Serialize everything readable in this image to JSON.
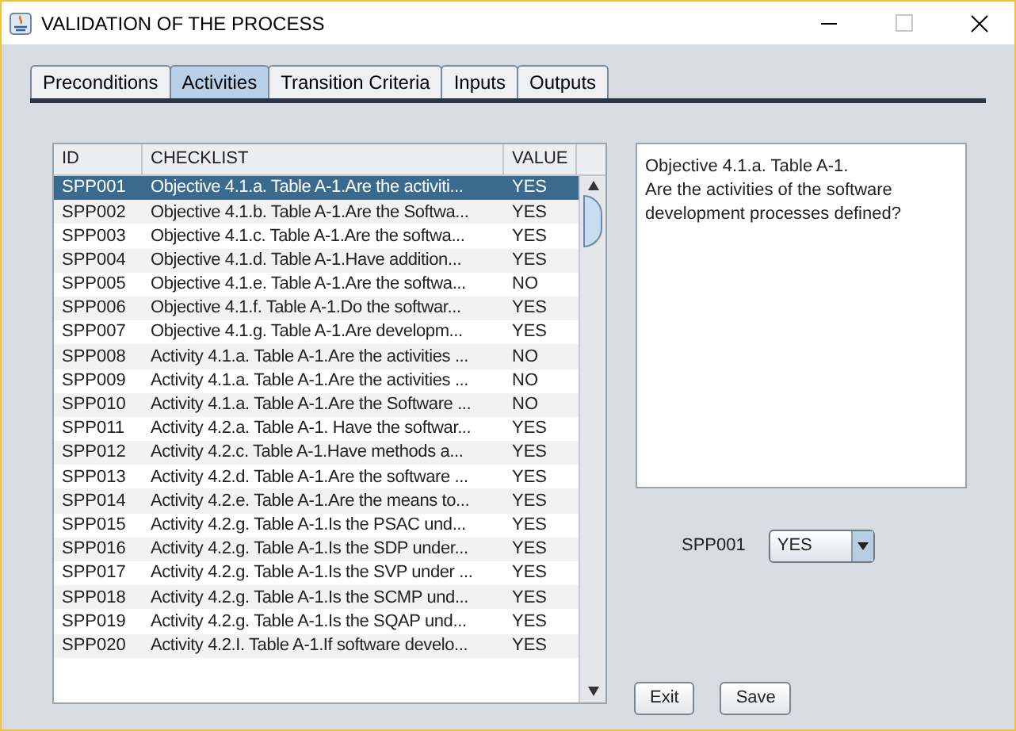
{
  "window": {
    "title": "VALIDATION OF THE PROCESS"
  },
  "tabs": [
    {
      "label": "Preconditions",
      "selected": false
    },
    {
      "label": "Activities",
      "selected": true
    },
    {
      "label": "Transition Criteria",
      "selected": false
    },
    {
      "label": "Inputs",
      "selected": false
    },
    {
      "label": "Outputs",
      "selected": false
    }
  ],
  "table": {
    "columns": [
      "ID",
      "CHECKLIST",
      "VALUE"
    ],
    "rows": [
      {
        "id": "SPP001",
        "checklist": "Objective 4.1.a. Table A-1.Are the activiti...",
        "value": "YES",
        "selected": true
      },
      {
        "id": "SPP002",
        "checklist": "Objective 4.1.b. Table A-1.Are the Softwa...",
        "value": "YES",
        "selected": false
      },
      {
        "id": "SPP003",
        "checklist": "Objective 4.1.c. Table A-1.Are the softwa...",
        "value": "YES",
        "selected": false
      },
      {
        "id": "SPP004",
        "checklist": "Objective 4.1.d. Table A-1.Have addition...",
        "value": "YES",
        "selected": false
      },
      {
        "id": "SPP005",
        "checklist": "Objective 4.1.e. Table A-1.Are the softwa...",
        "value": "NO",
        "selected": false
      },
      {
        "id": "SPP006",
        "checklist": "Objective 4.1.f. Table A-1.Do the softwar...",
        "value": "YES",
        "selected": false
      },
      {
        "id": "SPP007",
        "checklist": "Objective 4.1.g. Table A-1.Are developm...",
        "value": "YES",
        "selected": false
      },
      {
        "id": "SPP008",
        "checklist": "Activity 4.1.a. Table A-1.Are the activities ...",
        "value": "NO",
        "selected": false
      },
      {
        "id": "SPP009",
        "checklist": "Activity 4.1.a. Table A-1.Are the activities ...",
        "value": "NO",
        "selected": false
      },
      {
        "id": "SPP010",
        "checklist": "Activity 4.1.a. Table A-1.Are the Software ...",
        "value": "NO",
        "selected": false
      },
      {
        "id": "SPP011",
        "checklist": "Activity 4.2.a. Table A-1. Have the softwar...",
        "value": "YES",
        "selected": false
      },
      {
        "id": "SPP012",
        "checklist": "Activity 4.2.c. Table A-1.Have methods a...",
        "value": "YES",
        "selected": false
      },
      {
        "id": "SPP013",
        "checklist": "Activity 4.2.d. Table A-1.Are the software ...",
        "value": "YES",
        "selected": false
      },
      {
        "id": "SPP014",
        "checklist": "Activity 4.2.e. Table A-1.Are the means to...",
        "value": "YES",
        "selected": false
      },
      {
        "id": "SPP015",
        "checklist": "Activity 4.2.g. Table A-1.Is the PSAC und...",
        "value": "YES",
        "selected": false
      },
      {
        "id": "SPP016",
        "checklist": "Activity 4.2.g. Table A-1.Is the SDP under...",
        "value": "YES",
        "selected": false
      },
      {
        "id": "SPP017",
        "checklist": "Activity 4.2.g. Table A-1.Is the SVP under ...",
        "value": "YES",
        "selected": false
      },
      {
        "id": "SPP018",
        "checklist": "Activity 4.2.g. Table A-1.Is the SCMP und...",
        "value": "YES",
        "selected": false
      },
      {
        "id": "SPP019",
        "checklist": "Activity 4.2.g. Table A-1.Is the SQAP und...",
        "value": "YES",
        "selected": false
      },
      {
        "id": "SPP020",
        "checklist": "Activity 4.2.I. Table A-1.If software develo...",
        "value": "YES",
        "selected": false
      }
    ]
  },
  "detail": {
    "lines": [
      "Objective 4.1.a. Table A-1.",
      "Are the activities of the software development processes defined?"
    ]
  },
  "selection": {
    "id": "SPP001",
    "value": "YES"
  },
  "buttons": [
    "Exit",
    "Save"
  ]
}
